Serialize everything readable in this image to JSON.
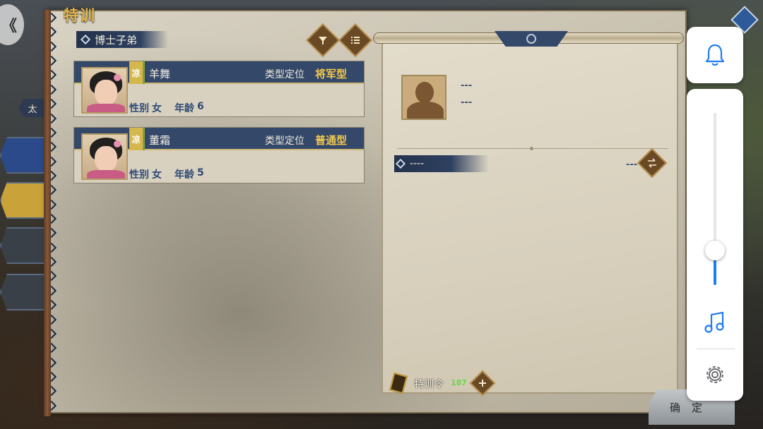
{
  "header": {
    "title": "特训",
    "back_glyph": "《"
  },
  "side_panel": {
    "label": "太",
    "tab_colors": [
      "#2a4a8a",
      "#c9a23a",
      "#3a4048",
      "#3a4048"
    ]
  },
  "section_tag": "博士子弟",
  "toolbar": {
    "filter_icon": "filter-icon",
    "list_icon": "list-icon"
  },
  "roster": [
    {
      "region": "凉",
      "name": "羊舞",
      "type_label": "类型定位",
      "type_value": "将军型",
      "gender_label": "性别",
      "gender": "女",
      "age_label": "年龄",
      "age": "6"
    },
    {
      "region": "凉",
      "name": "董霜",
      "type_label": "类型定位",
      "type_value": "普通型",
      "gender_label": "性别",
      "gender": "女",
      "age_label": "年龄",
      "age": "5"
    }
  ],
  "detail": {
    "line1": "---",
    "line2": "---",
    "bar_label": "----",
    "bar_value": "---",
    "swap_icon": "swap-icon"
  },
  "training": {
    "label": "特训令",
    "count": "187",
    "add_icon": "plus-icon"
  },
  "confirm_button": "确定",
  "overlay": {
    "bell_icon": "bell-icon",
    "music_icon": "music-note-icon",
    "gear_icon": "gear-icon",
    "volume_level": 0.2,
    "accent": "#1f7cf2"
  }
}
